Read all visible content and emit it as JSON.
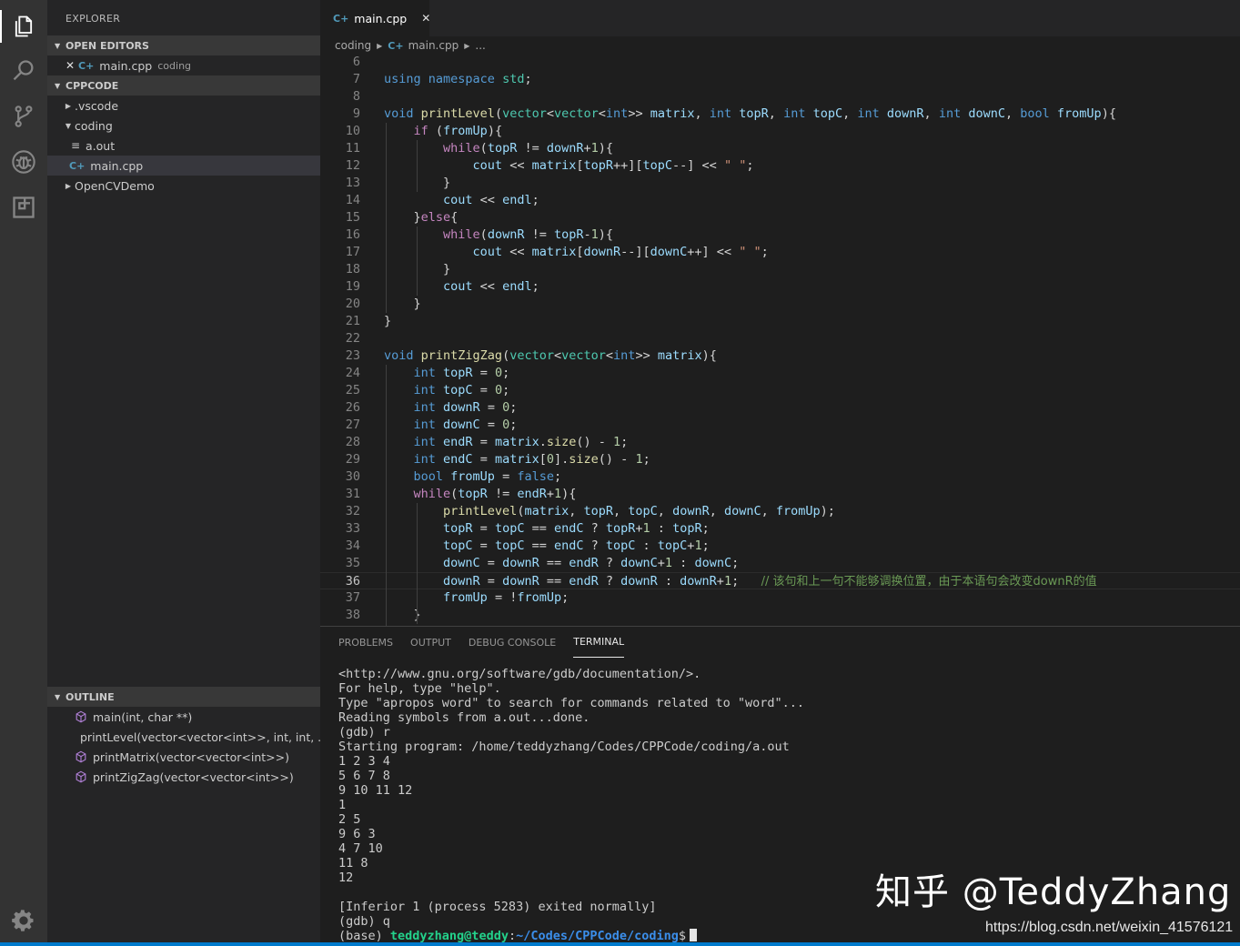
{
  "sidebar": {
    "title": "EXPLORER",
    "open_editors_header": "OPEN EDITORS",
    "open_editor": {
      "name": "main.cpp",
      "desc": "coding"
    },
    "project_header": "CPPCODE",
    "tree": [
      {
        "label": ".vscode",
        "type": "folder-collapsed"
      },
      {
        "label": "coding",
        "type": "folder-expanded"
      },
      {
        "label": "a.out",
        "type": "file"
      },
      {
        "label": "main.cpp",
        "type": "cpp-file",
        "selected": true
      },
      {
        "label": "OpenCVDemo",
        "type": "folder-collapsed"
      }
    ],
    "outline_header": "OUTLINE",
    "outline": [
      "main(int, char **)",
      "printLevel(vector<vector<int>>, int, int, ...",
      "printMatrix(vector<vector<int>>)",
      "printZigZag(vector<vector<int>>)"
    ]
  },
  "editor": {
    "tab_label": "main.cpp",
    "breadcrumb": [
      "coding",
      "main.cpp",
      "..."
    ],
    "current_line": 36,
    "lines": [
      {
        "n": "6",
        "html": ""
      },
      {
        "n": "7",
        "html": "<span class='kw'>using</span> <span class='kw'>namespace</span> <span class='ns'>std</span>;"
      },
      {
        "n": "8",
        "html": ""
      },
      {
        "n": "9",
        "html": "<span class='kw'>void</span> <span class='fn'>printLevel</span>(<span class='ty'>vector</span>&lt;<span class='ty'>vector</span>&lt;<span class='kw'>int</span>&gt;&gt; <span class='var'>matrix</span>, <span class='kw'>int</span> <span class='var'>topR</span>, <span class='kw'>int</span> <span class='var'>topC</span>, <span class='kw'>int</span> <span class='var'>downR</span>, <span class='kw'>int</span> <span class='var'>downC</span>, <span class='kw'>bool</span> <span class='var'>fromUp</span>){"
      },
      {
        "n": "10",
        "html": "    <span class='ctl'>if</span> (<span class='var'>fromUp</span>){"
      },
      {
        "n": "11",
        "html": "        <span class='ctl'>while</span>(<span class='var'>topR</span> != <span class='var'>downR</span>+<span class='num'>1</span>){"
      },
      {
        "n": "12",
        "html": "            <span class='var'>cout</span> &lt;&lt; <span class='var'>matrix</span>[<span class='var'>topR</span>++][<span class='var'>topC</span>--] &lt;&lt; <span class='str'>\" \"</span>;"
      },
      {
        "n": "13",
        "html": "        }"
      },
      {
        "n": "14",
        "html": "        <span class='var'>cout</span> &lt;&lt; <span class='var'>endl</span>;"
      },
      {
        "n": "15",
        "html": "    }<span class='ctl'>else</span>{"
      },
      {
        "n": "16",
        "html": "        <span class='ctl'>while</span>(<span class='var'>downR</span> != <span class='var'>topR</span>-<span class='num'>1</span>){"
      },
      {
        "n": "17",
        "html": "            <span class='var'>cout</span> &lt;&lt; <span class='var'>matrix</span>[<span class='var'>downR</span>--][<span class='var'>downC</span>++] &lt;&lt; <span class='str'>\" \"</span>;"
      },
      {
        "n": "18",
        "html": "        }"
      },
      {
        "n": "19",
        "html": "        <span class='var'>cout</span> &lt;&lt; <span class='var'>endl</span>;"
      },
      {
        "n": "20",
        "html": "    }"
      },
      {
        "n": "21",
        "html": "}"
      },
      {
        "n": "22",
        "html": ""
      },
      {
        "n": "23",
        "html": "<span class='kw'>void</span> <span class='fn'>printZigZag</span>(<span class='ty'>vector</span>&lt;<span class='ty'>vector</span>&lt;<span class='kw'>int</span>&gt;&gt; <span class='var'>matrix</span>){"
      },
      {
        "n": "24",
        "html": "    <span class='kw'>int</span> <span class='var'>topR</span> = <span class='num'>0</span>;"
      },
      {
        "n": "25",
        "html": "    <span class='kw'>int</span> <span class='var'>topC</span> = <span class='num'>0</span>;"
      },
      {
        "n": "26",
        "html": "    <span class='kw'>int</span> <span class='var'>downR</span> = <span class='num'>0</span>;"
      },
      {
        "n": "27",
        "html": "    <span class='kw'>int</span> <span class='var'>downC</span> = <span class='num'>0</span>;"
      },
      {
        "n": "28",
        "html": "    <span class='kw'>int</span> <span class='var'>endR</span> = <span class='var'>matrix</span>.<span class='fn'>size</span>() - <span class='num'>1</span>;"
      },
      {
        "n": "29",
        "html": "    <span class='kw'>int</span> <span class='var'>endC</span> = <span class='var'>matrix</span>[<span class='num'>0</span>].<span class='fn'>size</span>() - <span class='num'>1</span>;"
      },
      {
        "n": "30",
        "html": "    <span class='kw'>bool</span> <span class='var'>fromUp</span> = <span class='kw'>false</span>;"
      },
      {
        "n": "31",
        "html": "    <span class='ctl'>while</span>(<span class='var'>topR</span> != <span class='var'>endR</span>+<span class='num'>1</span>){"
      },
      {
        "n": "32",
        "html": "        <span class='fn'>printLevel</span>(<span class='var'>matrix</span>, <span class='var'>topR</span>, <span class='var'>topC</span>, <span class='var'>downR</span>, <span class='var'>downC</span>, <span class='var'>fromUp</span>);"
      },
      {
        "n": "33",
        "html": "        <span class='var'>topR</span> = <span class='var'>topC</span> == <span class='var'>endC</span> ? <span class='var'>topR</span>+<span class='num'>1</span> : <span class='var'>topR</span>;"
      },
      {
        "n": "34",
        "html": "        <span class='var'>topC</span> = <span class='var'>topC</span> == <span class='var'>endC</span> ? <span class='var'>topC</span> : <span class='var'>topC</span>+<span class='num'>1</span>;"
      },
      {
        "n": "35",
        "html": "        <span class='var'>downC</span> = <span class='var'>downR</span> == <span class='var'>endR</span> ? <span class='var'>downC</span>+<span class='num'>1</span> : <span class='var'>downC</span>;"
      },
      {
        "n": "36",
        "html": "        <span class='var'>downR</span> = <span class='var'>downR</span> == <span class='var'>endR</span> ? <span class='var'>downR</span> : <span class='var'>downR</span>+<span class='num'>1</span>;   <span class='cm'>// 该句和上一句不能够调换位置，由于本语句会改变downR的值</span>"
      },
      {
        "n": "37",
        "html": "        <span class='var'>fromUp</span> = !<span class='var'>fromUp</span>;"
      },
      {
        "n": "38",
        "html": "    }"
      }
    ]
  },
  "panel": {
    "tabs": [
      "PROBLEMS",
      "OUTPUT",
      "DEBUG CONSOLE",
      "TERMINAL"
    ],
    "active_tab": "TERMINAL",
    "terminal_lines": [
      "<http://www.gnu.org/software/gdb/documentation/>.",
      "For help, type \"help\".",
      "Type \"apropos word\" to search for commands related to \"word\"...",
      "Reading symbols from a.out...done.",
      "(gdb) r",
      "Starting program: /home/teddyzhang/Codes/CPPCode/coding/a.out",
      "1 2 3 4",
      "5 6 7 8",
      "9 10 11 12",
      "1",
      "2 5",
      "9 6 3",
      "4 7 10",
      "11 8",
      "12",
      "",
      "[Inferior 1 (process 5283) exited normally]",
      "(gdb) q"
    ],
    "prompt": {
      "prefix": "(base) ",
      "user": "teddyzhang@teddy",
      "colon": ":",
      "path": "~/Codes/CPPCode/coding",
      "suffix": "$"
    }
  },
  "overlay": {
    "watermark": "知乎 @TeddyZhang",
    "url": "https://blog.csdn.net/weixin_41576121"
  },
  "colors": {
    "activity_bar": "#333333",
    "sidebar": "#252526",
    "editor_bg": "#1e1e1e",
    "cpp_icon": "#519aba",
    "accent": "#007acc"
  },
  "icons": [
    "files-icon",
    "search-icon",
    "source-control-icon",
    "debug-icon",
    "extensions-icon",
    "gear-icon",
    "cpp-file-icon",
    "symbol-method-icon"
  ]
}
